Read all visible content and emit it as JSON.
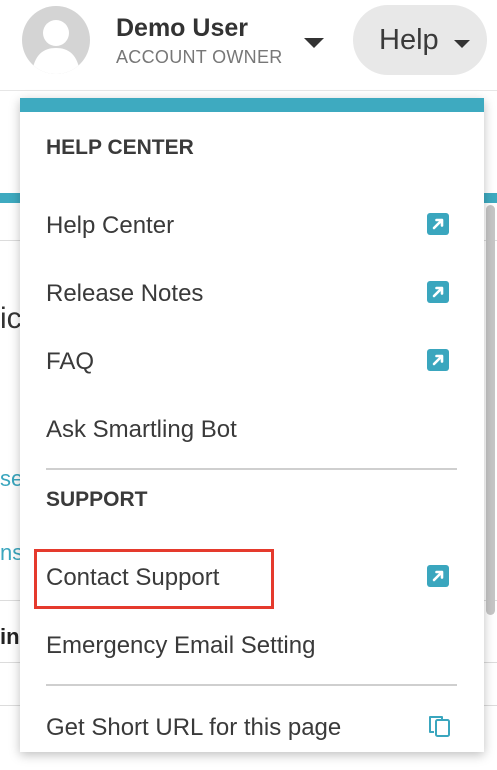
{
  "header": {
    "user_name": "Demo User",
    "user_role": "ACCOUNT OWNER",
    "help_label": "Help"
  },
  "background": {
    "fragment_1": "ic",
    "fragment_2": "se",
    "fragment_3": "ns",
    "fragment_4": "in,"
  },
  "menu": {
    "help_center_heading": "HELP CENTER",
    "support_heading": "SUPPORT",
    "items": [
      {
        "label": "Help Center",
        "icon": "external-link-icon"
      },
      {
        "label": "Release Notes",
        "icon": "external-link-icon"
      },
      {
        "label": "FAQ",
        "icon": "external-link-icon"
      },
      {
        "label": "Ask Smartling Bot",
        "icon": ""
      },
      {
        "label": "Contact Support",
        "icon": "external-link-icon"
      },
      {
        "label": "Emergency Email Setting",
        "icon": ""
      },
      {
        "label": "Get Short URL for this page",
        "icon": "copy-icon"
      }
    ]
  },
  "colors": {
    "accent": "#3eaac0",
    "highlight": "#e53a2d"
  }
}
